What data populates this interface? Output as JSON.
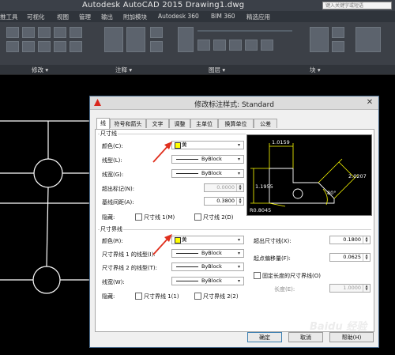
{
  "app": {
    "title": "Autodesk AutoCAD 2015    Drawing1.dwg",
    "search_placeholder": "键入关键字或短语"
  },
  "ribbon": {
    "tabs": [
      "",
      "插入",
      "注释",
      "参数化",
      "视图",
      "管理",
      "输出",
      "附加模块",
      "Autodesk 360",
      "BIM 360",
      "精选应用"
    ],
    "tab_labels_visible": [
      "推工具",
      "可视化",
      "视图",
      "管理",
      "输出",
      "附加模块",
      "Autodesk 360",
      "BIM 360",
      "精选应用"
    ],
    "panels": [
      "修改 ▾",
      "注释 ▾",
      "图层 ▾",
      "块 ▾"
    ]
  },
  "dialog": {
    "title": "修改标注样式: Standard",
    "tabs": [
      "线",
      "符号和箭头",
      "文字",
      "调整",
      "主单位",
      "换算单位",
      "公差"
    ],
    "dim_lines": {
      "group_title": "尺寸线",
      "color_label": "颜色(C):",
      "color_value": "黄",
      "linetype_label": "线型(L):",
      "linetype_value": "ByBlock",
      "lineweight_label": "线宽(G):",
      "lineweight_value": "ByBlock",
      "extend_label": "超出标记(N):",
      "extend_value": "0.0000",
      "baseline_label": "基线间距(A):",
      "baseline_value": "0.3800",
      "suppress_label": "隐藏:",
      "suppress_1": "尺寸线 1(M)",
      "suppress_2": "尺寸线 2(D)"
    },
    "ext_lines": {
      "group_title": "尺寸界线",
      "color_label": "颜色(R):",
      "color_value": "黄",
      "linetype1_label": "尺寸界线 1 的线型(I):",
      "linetype1_value": "ByBlock",
      "linetype2_label": "尺寸界线 2 的线型(T):",
      "linetype2_value": "ByBlock",
      "lineweight_label": "线宽(W):",
      "lineweight_value": "ByBlock",
      "suppress_label": "隐藏:",
      "suppress_1": "尺寸界线 1(1)",
      "suppress_2": "尺寸界线 2(2)",
      "extend_label": "超出尺寸线(X):",
      "extend_value": "0.1800",
      "offset_label": "起点偏移量(F):",
      "offset_value": "0.0625",
      "fixed_label": "固定长度的尺寸界线(O)",
      "length_label": "长度(E):",
      "length_value": "1.0000"
    },
    "preview": {
      "dim_top": "1.0159",
      "dim_left": "1.1955",
      "dim_right": "2.0207",
      "angle": "80°",
      "radius": "R0.8045"
    },
    "buttons": {
      "ok": "确定",
      "cancel": "取消",
      "help": "帮助(H)"
    }
  },
  "colors": {
    "accent_yellow": "#ffff00",
    "dim_line": "#ffff00",
    "drawing_bg": "#000000",
    "annotation_red": "#e0301e"
  },
  "watermark": "Baidu 经验"
}
